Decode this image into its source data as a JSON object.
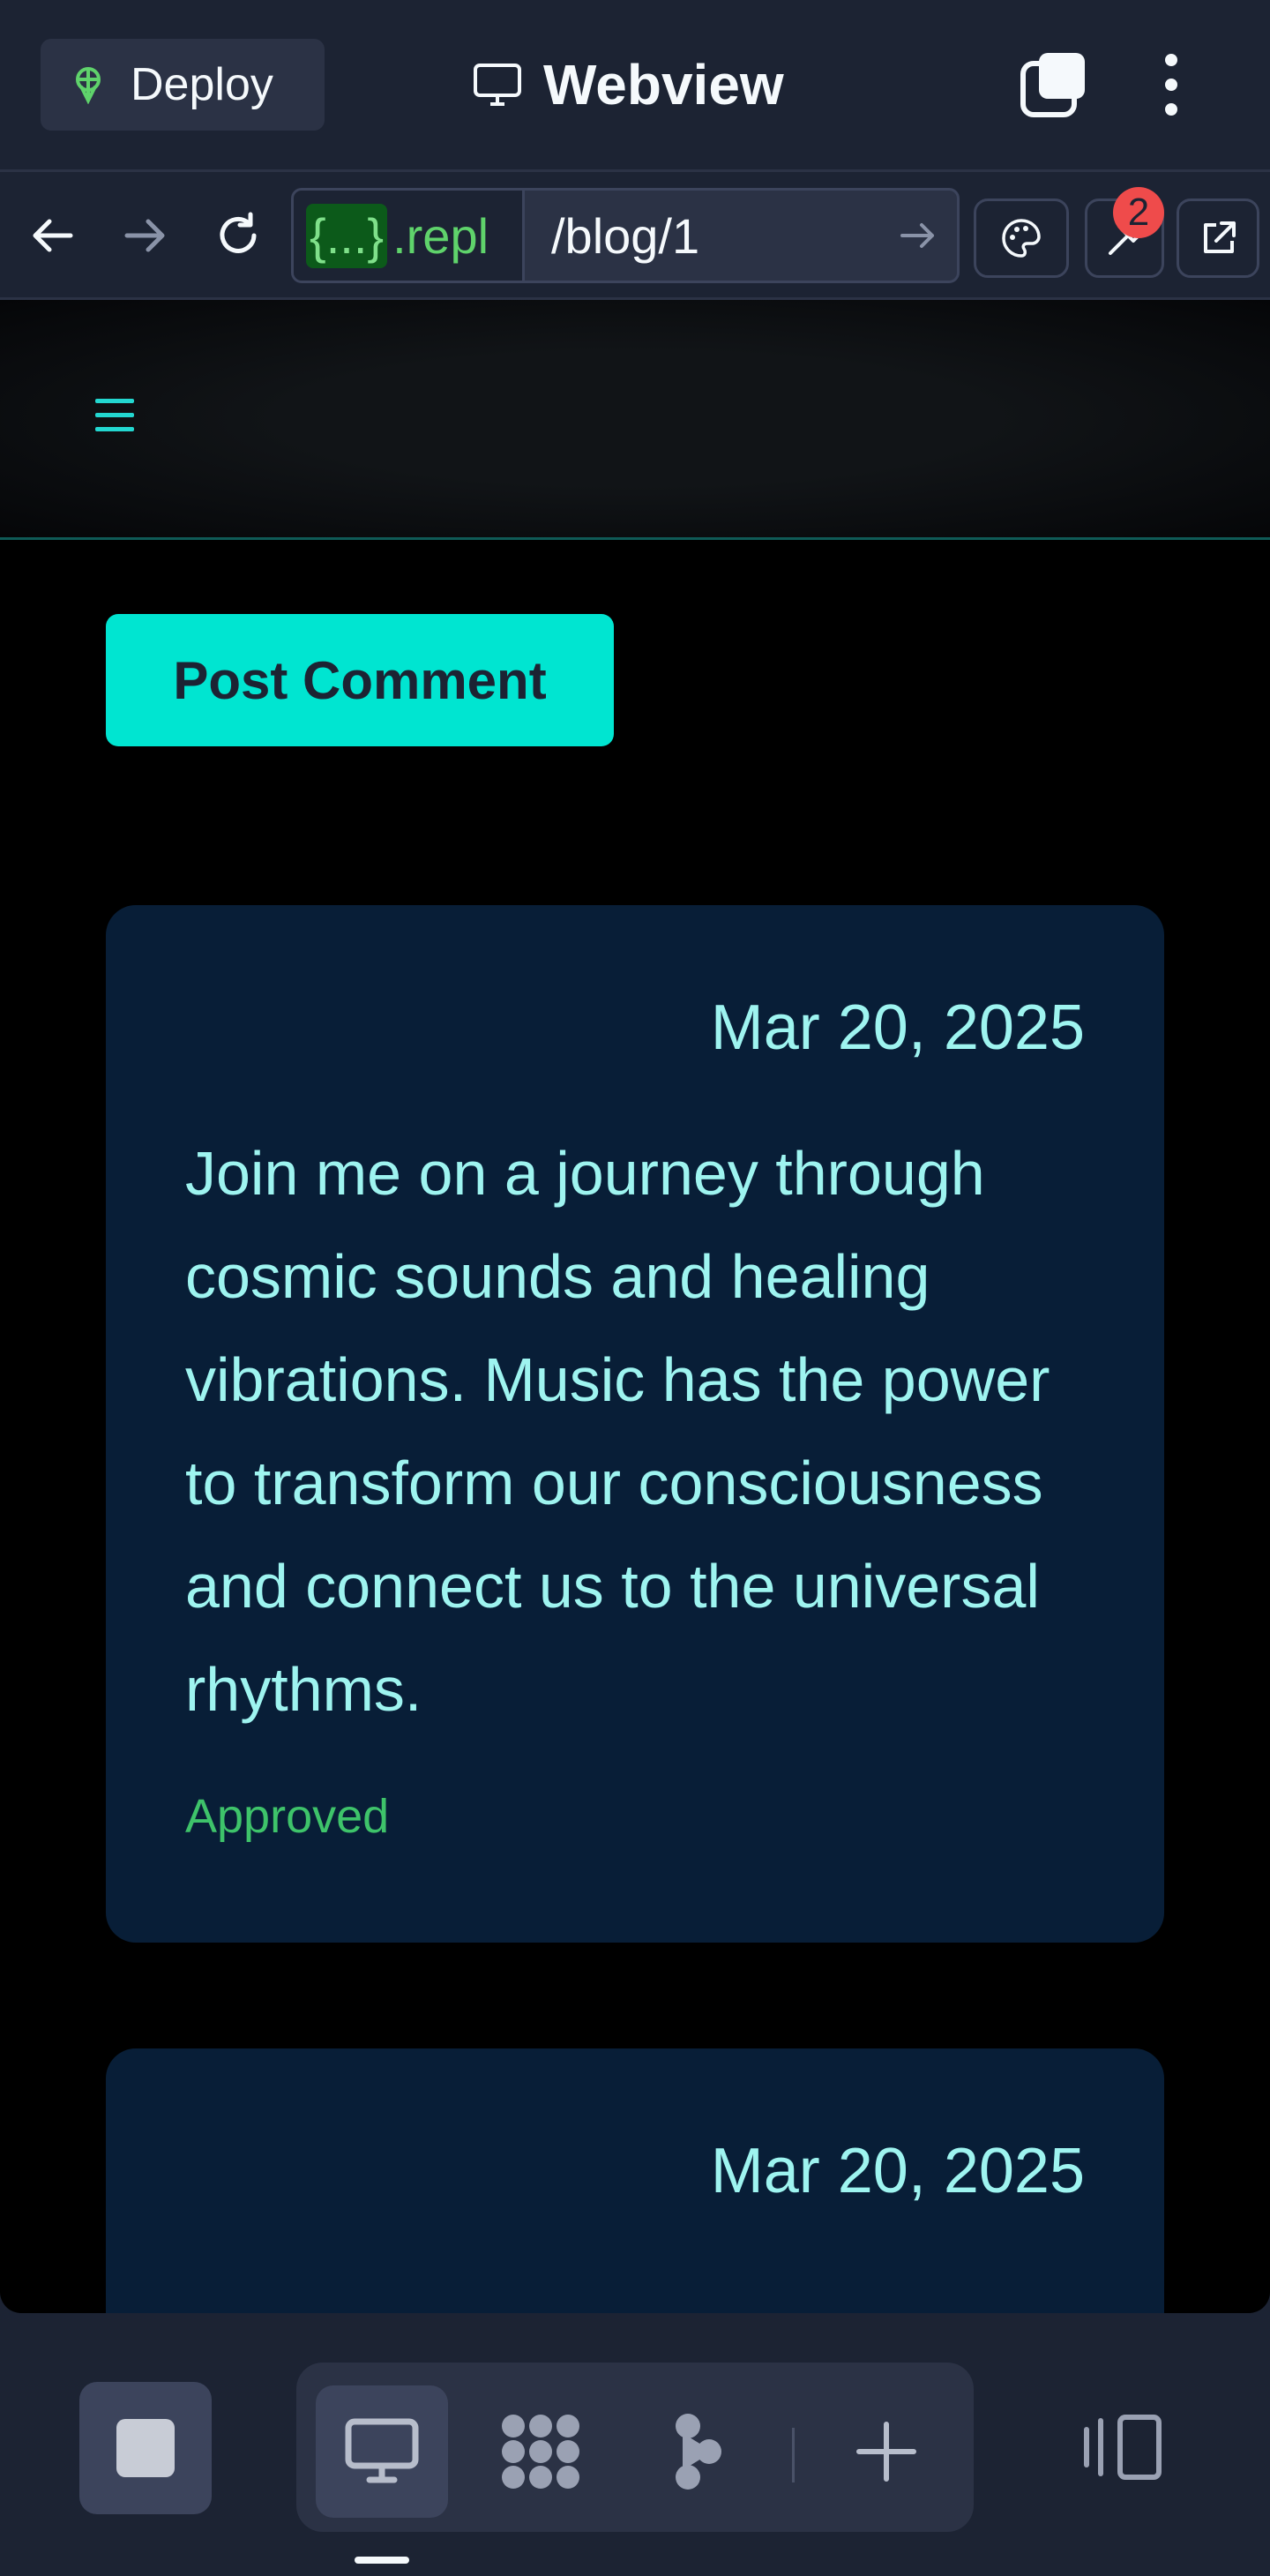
{
  "topbar": {
    "deploy_label": "Deploy",
    "title": "Webview",
    "icons": [
      "deploy-icon",
      "monitor-icon",
      "tabs-icon",
      "kebab-menu-icon"
    ]
  },
  "urlbar": {
    "domain_braces": "{...}",
    "domain_suffix": ".repl",
    "path": "/blog/1",
    "devtools_badge": "2",
    "icons": [
      "back-arrow-icon",
      "forward-arrow-icon",
      "reload-icon",
      "go-arrow-icon",
      "palette-icon",
      "wrench-icon",
      "external-link-icon"
    ]
  },
  "page": {
    "post_comment_label": "Post Comment",
    "comments": [
      {
        "date": "Mar 20, 2025",
        "body": "Join me on a journey through cosmic sounds and healing vibrations. Music has the power to transform our consciousness and connect us to the universal rhythms.",
        "status": "Approved"
      },
      {
        "date": "Mar 20, 2025"
      }
    ]
  },
  "bottombar": {
    "icons": [
      "stop-icon",
      "desktop-icon",
      "workflows-icon",
      "agent-icon",
      "plus-icon",
      "layout-toggle-icon"
    ]
  },
  "colors": {
    "accent": "#00e5d1",
    "card_bg": "#081e37",
    "card_text": "#9ef4f0",
    "approved": "#3ec36a",
    "ide_bg": "#1c2333"
  }
}
